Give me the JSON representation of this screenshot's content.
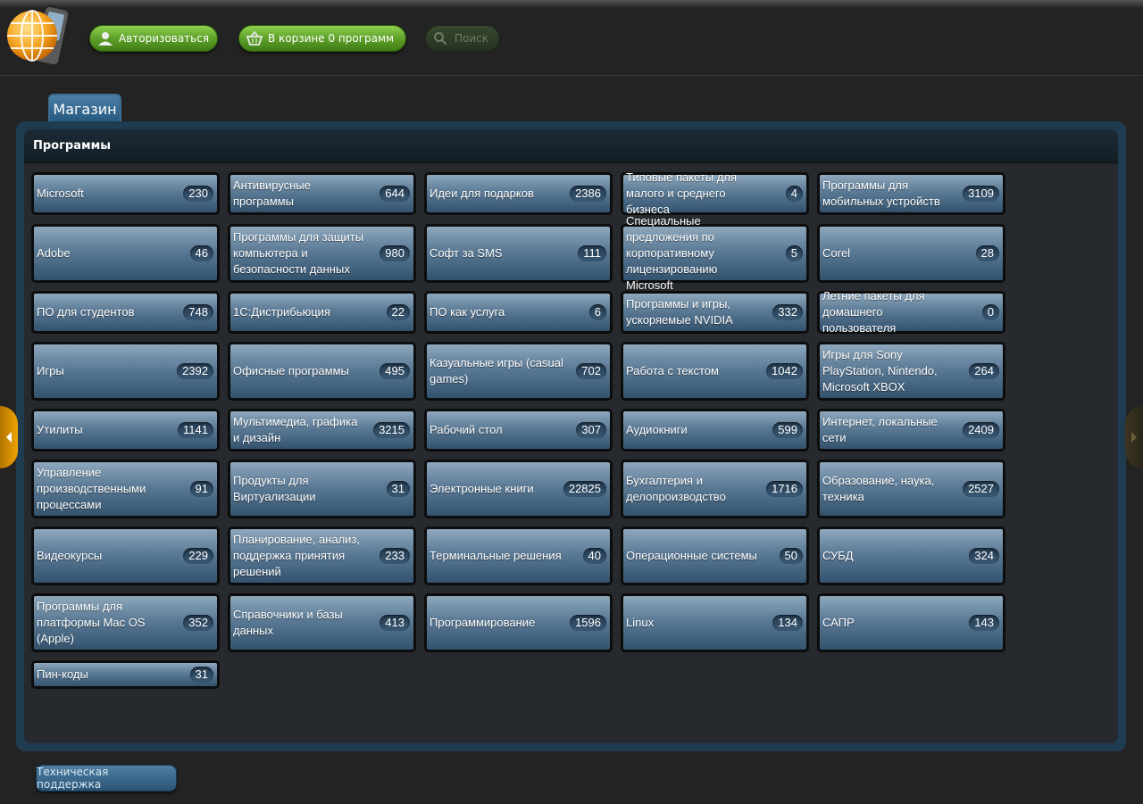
{
  "header": {
    "login_label": "Авторизоваться",
    "cart_label": "В корзине 0 программ",
    "search_placeholder": "Поиск"
  },
  "store_tab": "Магазин",
  "section_title": "Программы",
  "categories": [
    {
      "label": "Microsoft",
      "count": "230"
    },
    {
      "label": "Антивирусные программы",
      "count": "644"
    },
    {
      "label": "Идеи для подарков",
      "count": "2386"
    },
    {
      "label": "Типовые пакеты для малого и среднего бизнеса",
      "count": "4"
    },
    {
      "label": "Программы для мобильных устройств",
      "count": "3109"
    },
    {
      "label": "Adobe",
      "count": "46"
    },
    {
      "label": "Программы для защиты компьютера и безопасности данных",
      "count": "980"
    },
    {
      "label": "Софт за SMS",
      "count": "111"
    },
    {
      "label": "Специальные предложения по корпоративному лицензированию Microsoft",
      "count": "5"
    },
    {
      "label": "Corel",
      "count": "28"
    },
    {
      "label": "ПО для студентов",
      "count": "748"
    },
    {
      "label": "1С:Дистрибьюция",
      "count": "22"
    },
    {
      "label": "ПО как услуга",
      "count": "6"
    },
    {
      "label": "Программы и игры, ускоряемые NVIDIA",
      "count": "332"
    },
    {
      "label": "Летние пакеты для домашнего пользователя",
      "count": "0"
    },
    {
      "label": "Игры",
      "count": "2392"
    },
    {
      "label": "Офисные программы",
      "count": "495"
    },
    {
      "label": "Казуальные игры (casual games)",
      "count": "702"
    },
    {
      "label": "Работа с текстом",
      "count": "1042"
    },
    {
      "label": "Игры для Sony PlayStation, Nintendo, Microsoft XBOX",
      "count": "264"
    },
    {
      "label": "Утилиты",
      "count": "1141"
    },
    {
      "label": "Мультимедиа, графика и дизайн",
      "count": "3215"
    },
    {
      "label": "Рабочий стол",
      "count": "307"
    },
    {
      "label": "Аудиокниги",
      "count": "599"
    },
    {
      "label": "Интернет, локальные сети",
      "count": "2409"
    },
    {
      "label": "Управление производственными процессами",
      "count": "91"
    },
    {
      "label": "Продукты для Виртуализации",
      "count": "31"
    },
    {
      "label": "Электронные книги",
      "count": "22825"
    },
    {
      "label": "Бухгалтерия и делопроизводство",
      "count": "1716"
    },
    {
      "label": "Образование, наука, техника",
      "count": "2527"
    },
    {
      "label": "Видеокурсы",
      "count": "229"
    },
    {
      "label": "Планирование, анализ, поддержка принятия решений",
      "count": "233"
    },
    {
      "label": "Терминальные решения",
      "count": "40"
    },
    {
      "label": "Операционные системы",
      "count": "50"
    },
    {
      "label": "СУБД",
      "count": "324"
    },
    {
      "label": "Программы для платформы Mac OS (Apple)",
      "count": "352"
    },
    {
      "label": "Справочники и базы данных",
      "count": "413"
    },
    {
      "label": "Программирование",
      "count": "1596"
    },
    {
      "label": "Linux",
      "count": "134"
    },
    {
      "label": "САПР",
      "count": "143"
    },
    {
      "label": "Пин-коды",
      "count": "31"
    }
  ],
  "footer": {
    "support_label": "Техническая поддержка"
  },
  "colors": {
    "accent_green": "#5fa12a",
    "tile_blue": "#5b7a95",
    "frame_blue": "#1f3b50",
    "arrow_orange": "#f0a400"
  }
}
